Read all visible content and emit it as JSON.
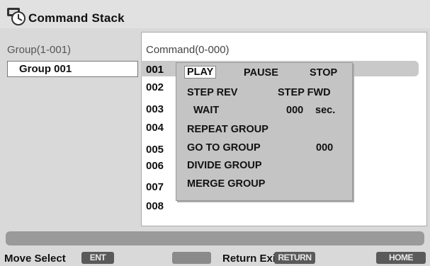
{
  "header": {
    "title": "Command Stack",
    "icon": "command-stack-icon"
  },
  "columns": {
    "group_header": "Group(1-001)",
    "command_header": "Command(0-000)"
  },
  "groups": [
    {
      "label": "Group 001"
    }
  ],
  "commands": {
    "rows": [
      "001",
      "002",
      "003",
      "004",
      "005",
      "006",
      "007",
      "008"
    ]
  },
  "menu": {
    "play": "PLAY",
    "pause": "PAUSE",
    "stop": "STOP",
    "step_rev": "STEP REV",
    "step_fwd": "STEP FWD",
    "wait": "WAIT",
    "wait_value": "000",
    "wait_unit": "sec.",
    "repeat_group": "REPEAT GROUP",
    "go_to_group": "GO TO GROUP",
    "go_to_value": "000",
    "divide_group": "DIVIDE GROUP",
    "merge_group": "MERGE GROUP"
  },
  "footer": {
    "move_select": "Move Select",
    "enter_button": "ENT",
    "return_exit": "Return Exit",
    "return_button": "RETURN",
    "home_menu_button": "HOME MENU"
  },
  "colors": {
    "panel": "#ffffff",
    "popup": "#c4c4c4",
    "status_bar": "#9a9a9a",
    "button": "#5a5a5a"
  }
}
